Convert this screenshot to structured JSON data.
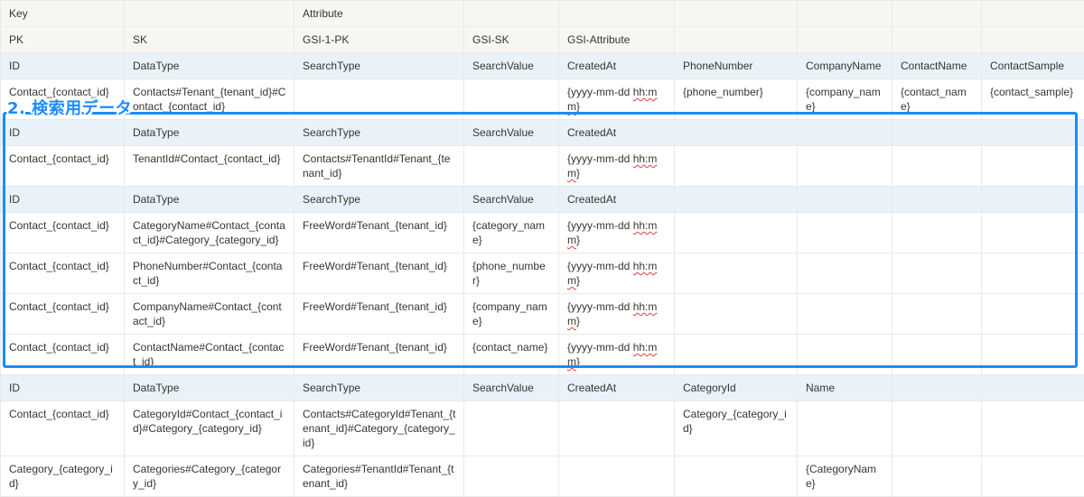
{
  "header_rows": [
    [
      "Key",
      "",
      "Attribute",
      "",
      "",
      "",
      "",
      "",
      ""
    ],
    [
      "PK",
      "SK",
      "GSI-1-PK",
      "GSI-SK",
      "GSI-Attribute",
      "",
      "",
      "",
      ""
    ],
    [
      "ID",
      "DataType",
      "SearchType",
      "SearchValue",
      "CreatedAt",
      "PhoneNumber",
      "CompanyName",
      "ContactName",
      "ContactSample"
    ],
    [
      "Contact_{contact_id}",
      "Contacts#Tenant_{tenant_id}#Contact_{contact_id}",
      "",
      "",
      "{yyyy-mm-dd hh:mm}",
      "{phone_number}",
      "{company_name}",
      "{contact_name}",
      "{contact_sample}"
    ],
    [
      "ID",
      "DataType",
      "SearchType",
      "SearchValue",
      "CreatedAt",
      "",
      "",
      "",
      ""
    ],
    [
      "Contact_{contact_id}",
      "TenantId#Contact_{contact_id}",
      "Contacts#TenantId#Tenant_{tenant_id}",
      "",
      "{yyyy-mm-dd hh:mm}",
      "",
      "",
      "",
      ""
    ],
    [
      "ID",
      "DataType",
      "SearchType",
      "SearchValue",
      "CreatedAt",
      "",
      "",
      "",
      ""
    ],
    [
      "Contact_{contact_id}",
      "CategoryName#Contact_{contact_id}#Category_{category_id}",
      "FreeWord#Tenant_{tenant_id}",
      "{category_name}",
      "{yyyy-mm-dd hh:mm}",
      "",
      "",
      "",
      ""
    ],
    [
      "Contact_{contact_id}",
      "PhoneNumber#Contact_{contact_id}",
      "FreeWord#Tenant_{tenant_id}",
      "{phone_number}",
      "{yyyy-mm-dd hh:mm}",
      "",
      "",
      "",
      ""
    ],
    [
      "Contact_{contact_id}",
      "CompanyName#Contact_{contact_id}",
      "FreeWord#Tenant_{tenant_id}",
      "{company_name}",
      "{yyyy-mm-dd hh:mm}",
      "",
      "",
      "",
      ""
    ],
    [
      "Contact_{contact_id}",
      "ContactName#Contact_{contact_id}",
      "FreeWord#Tenant_{tenant_id}",
      "{contact_name}",
      "{yyyy-mm-dd hh:mm}",
      "",
      "",
      "",
      ""
    ],
    [
      "ID",
      "DataType",
      "SearchType",
      "SearchValue",
      "CreatedAt",
      "CategoryId",
      "Name",
      "",
      ""
    ],
    [
      "Contact_{contact_id}",
      "CategoryId#Contact_{contact_id}#Category_{category_id}",
      "Contacts#CategoryId#Tenant_{tenant_id}#Category_{category_id}",
      "",
      "",
      "Category_{category_id}",
      "",
      "",
      ""
    ],
    [
      "Category_{category_id}",
      "Categories#Category_{category_id}",
      "Categories#TenantId#Tenant_{tenant_id}",
      "",
      "",
      "",
      "{CategoryName}",
      "",
      ""
    ]
  ],
  "row_types": [
    "hdr",
    "hdr",
    "idrow",
    "data",
    "idrow",
    "data",
    "idrow",
    "data",
    "data",
    "data",
    "data",
    "idrow",
    "data",
    "data"
  ],
  "annotation": {
    "label": "2. 検索用データ",
    "color": "#1a8cff"
  },
  "colors": {
    "header_bg": "#f7f6f3",
    "id_row_bg": "#eaf2f9",
    "border": "#e9e9e7",
    "text": "#37352f"
  }
}
